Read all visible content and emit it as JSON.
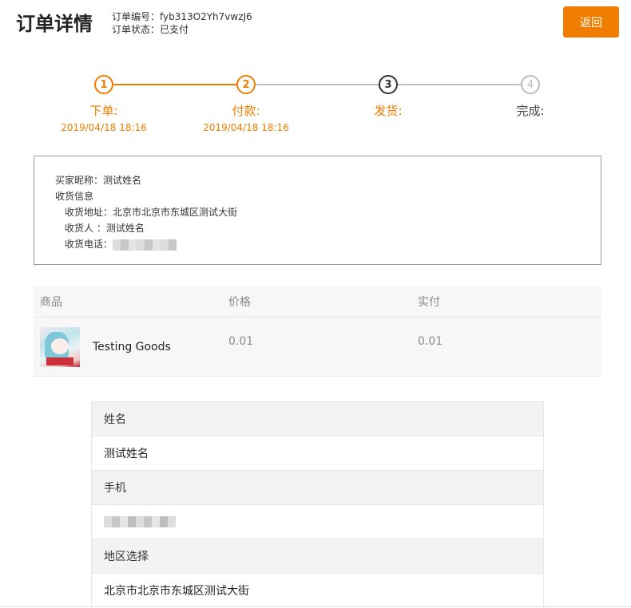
{
  "header": {
    "title": "订单详情",
    "order_no": "订单编号：fyb313O2Yh7vwzJ6",
    "order_status": "订单状态：已支付",
    "back_label": "返回"
  },
  "steps": [
    {
      "num": "1",
      "label": "下单:",
      "time": "2019/04/18 18:16",
      "state": "done"
    },
    {
      "num": "2",
      "label": "付款:",
      "time": "2019/04/18 18:16",
      "state": "done"
    },
    {
      "num": "3",
      "label": "发货:",
      "time": "",
      "state": "current"
    },
    {
      "num": "4",
      "label": "完成:",
      "time": "",
      "state": "pending"
    }
  ],
  "colors": {
    "accent": "#f07d00",
    "pending": "#bbbbbb"
  },
  "buyer": {
    "nickname": "买家昵称：测试姓名",
    "shipping_title": "收货信息",
    "address": "收货地址：北京市北京市东城区测试大街",
    "receiver": "收货人 ：测试姓名",
    "phone_label": "收货电话："
  },
  "goods": {
    "headers": [
      "商品",
      "价格",
      "实付"
    ],
    "rows": [
      {
        "name": "Testing Goods",
        "price": "0.01",
        "paid": "0.01"
      }
    ]
  },
  "form": {
    "name_label": "姓名",
    "name_value": "测试姓名",
    "mobile_label": "手机",
    "region_label": "地区选择",
    "region_value": "北京市北京市东城区测试大街"
  }
}
